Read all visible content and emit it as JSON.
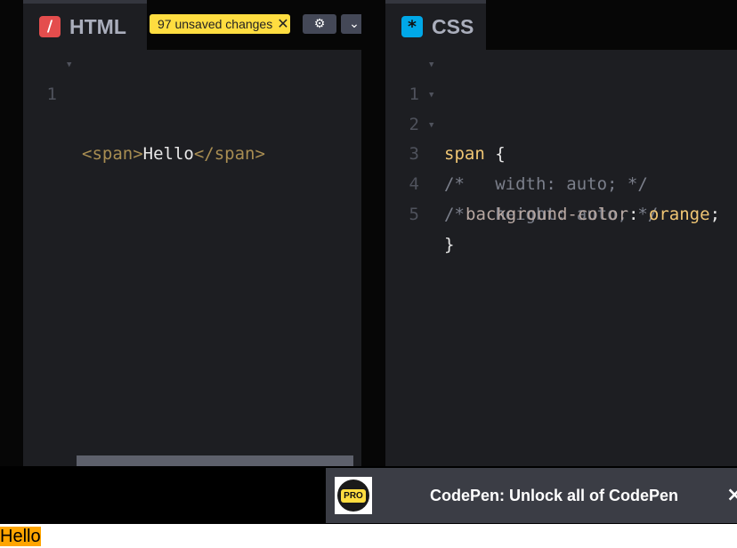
{
  "html_editor": {
    "tab_label": "HTML",
    "icon": "slash-icon",
    "icon_glyph": "/",
    "unsaved_badge": "97 unsaved changes",
    "badge_close": "✕",
    "settings_icon": "gear-icon",
    "settings_glyph": "⚙",
    "menu_icon": "chevron-down-icon",
    "menu_glyph": "⌄",
    "lines": [
      {
        "num": "1",
        "open": "<span>",
        "text": "Hello",
        "close": "</span>"
      }
    ]
  },
  "css_editor": {
    "tab_label": "CSS",
    "icon": "asterisk-icon",
    "icon_glyph": "*",
    "lines": [
      {
        "num": "1",
        "selector": "span",
        "brace": " {"
      },
      {
        "num": "2",
        "comment": "/*   width: auto; */"
      },
      {
        "num": "3",
        "comment": "/*   height: auto; */"
      },
      {
        "num": "4",
        "property": "background-color",
        "colon": ": ",
        "value": "orange",
        "semi": ";"
      },
      {
        "num": "5",
        "brace": "}"
      }
    ]
  },
  "promo": {
    "logo_text": "PRO",
    "text": "CodePen: Unlock all of CodePen",
    "close": "×"
  },
  "preview": {
    "text": "Hello",
    "bg_color": "orange"
  },
  "colors": {
    "editor_bg": "#1d1e22",
    "badge_bg": "#ffdd40",
    "html_icon": "#e44d4d",
    "css_icon": "#00a8e8"
  }
}
